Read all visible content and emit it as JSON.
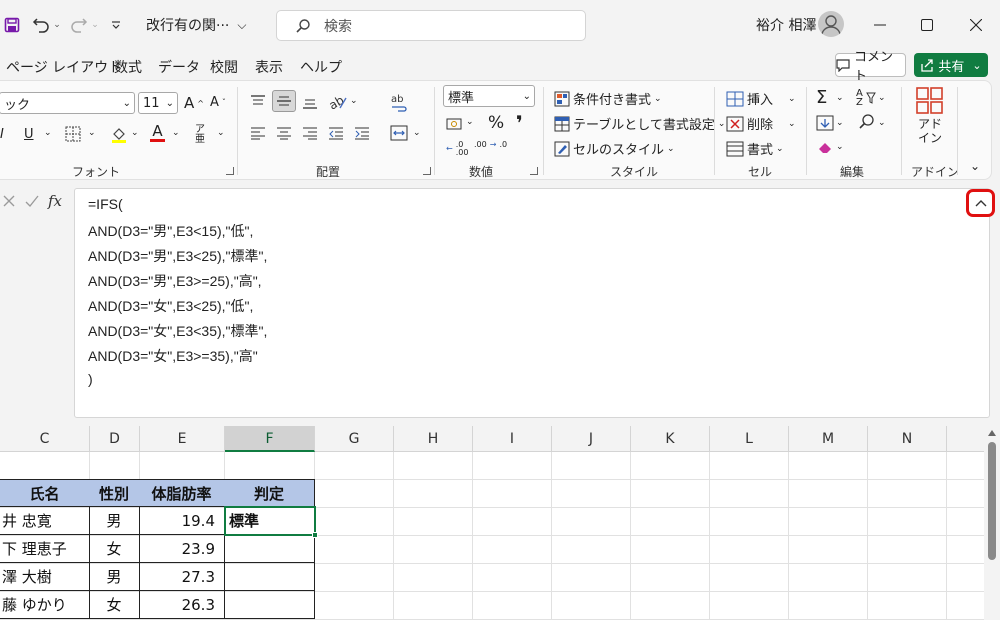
{
  "titlebar": {
    "doc_title": "改行有の関···",
    "search_placeholder": "検索",
    "user_name": "裕介 相澤"
  },
  "menu": {
    "tabs": [
      "ページ レイアウト",
      "数式",
      "データ",
      "校閲",
      "表示",
      "ヘルプ"
    ],
    "comment_label": "コメント",
    "share_label": "共有"
  },
  "ribbon": {
    "font_name": "ック",
    "font_size": "11",
    "number_format": "標準",
    "groups": {
      "font": "フォント",
      "alignment": "配置",
      "number": "数値",
      "styles": "スタイル",
      "cells": "セル",
      "editing": "編集",
      "addins": "アドイン"
    },
    "styles": {
      "conditional": "条件付き書式",
      "as_table": "テーブルとして書式設定",
      "cell_styles": "セルのスタイル"
    },
    "cells": {
      "insert": "挿入",
      "delete": "削除",
      "format": "書式"
    },
    "addin_label": "アド\nイン"
  },
  "formula": {
    "fx": "fx",
    "lines": [
      "=IFS(",
      "AND(D3=\"男\",E3<15),\"低\",",
      "AND(D3=\"男\",E3<25),\"標準\",",
      "AND(D3=\"男\",E3>=25),\"高\",",
      "AND(D3=\"女\",E3<25),\"低\",",
      "AND(D3=\"女\",E3<35),\"標準\",",
      "AND(D3=\"女\",E3>=35),\"高\"",
      ")"
    ]
  },
  "sheet": {
    "columns": [
      "C",
      "D",
      "E",
      "F",
      "G",
      "H",
      "I",
      "J",
      "K",
      "L",
      "M",
      "N"
    ],
    "selected_column": "F",
    "table_headers": [
      "氏名",
      "性別",
      "体脂肪率",
      "判定"
    ],
    "rows": [
      [
        "井 忠寛",
        "男",
        "19.4",
        "標準"
      ],
      [
        "下 理恵子",
        "女",
        "23.9",
        ""
      ],
      [
        "澤 大樹",
        "男",
        "27.3",
        ""
      ],
      [
        "藤 ゆかり",
        "女",
        "26.3",
        ""
      ]
    ]
  },
  "colors": {
    "accent_green": "#107c41",
    "table_header": "#b4c6e7",
    "highlight_red": "#e01010"
  }
}
